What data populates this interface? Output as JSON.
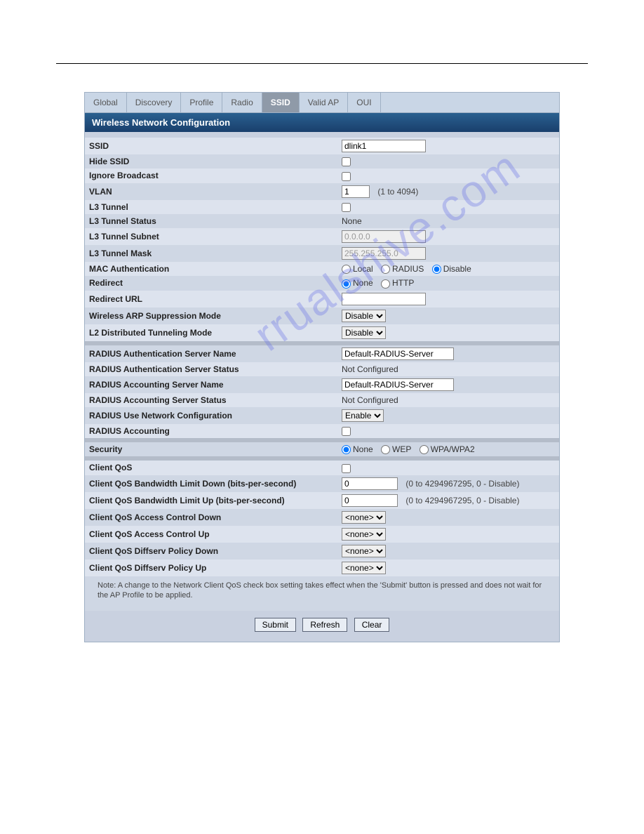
{
  "watermark": "rrualshive.com",
  "tabs": [
    {
      "label": "Global",
      "active": false
    },
    {
      "label": "Discovery",
      "active": false
    },
    {
      "label": "Profile",
      "active": false
    },
    {
      "label": "Radio",
      "active": false
    },
    {
      "label": "SSID",
      "active": true
    },
    {
      "label": "Valid AP",
      "active": false
    },
    {
      "label": "OUI",
      "active": false
    }
  ],
  "section_title": "Wireless Network Configuration",
  "fields": {
    "ssid": {
      "label": "SSID",
      "value": "dlink1"
    },
    "hide_ssid": {
      "label": "Hide SSID",
      "checked": false
    },
    "ignore_broadcast": {
      "label": "Ignore Broadcast",
      "checked": false
    },
    "vlan": {
      "label": "VLAN",
      "value": "1",
      "hint": "(1 to 4094)"
    },
    "l3_tunnel": {
      "label": "L3 Tunnel",
      "checked": false
    },
    "l3_tunnel_status": {
      "label": "L3 Tunnel Status",
      "value": "None"
    },
    "l3_tunnel_subnet": {
      "label": "L3 Tunnel Subnet",
      "value": "0.0.0.0"
    },
    "l3_tunnel_mask": {
      "label": "L3 Tunnel Mask",
      "value": "255.255.255.0"
    },
    "mac_auth": {
      "label": "MAC Authentication",
      "options": [
        "Local",
        "RADIUS",
        "Disable"
      ],
      "selected": "Disable"
    },
    "redirect": {
      "label": "Redirect",
      "options": [
        "None",
        "HTTP"
      ],
      "selected": "None"
    },
    "redirect_url": {
      "label": "Redirect URL",
      "value": ""
    },
    "arp_supp": {
      "label": "Wireless ARP Suppression Mode",
      "value": "Disable"
    },
    "l2_tunnel": {
      "label": "L2 Distributed Tunneling Mode",
      "value": "Disable"
    },
    "radius_auth_name": {
      "label": "RADIUS Authentication Server Name",
      "value": "Default-RADIUS-Server"
    },
    "radius_auth_status": {
      "label": "RADIUS Authentication Server Status",
      "value": "Not Configured"
    },
    "radius_acct_name": {
      "label": "RADIUS Accounting Server Name",
      "value": "Default-RADIUS-Server"
    },
    "radius_acct_status": {
      "label": "RADIUS Accounting Server Status",
      "value": "Not Configured"
    },
    "radius_use_net": {
      "label": "RADIUS Use Network Configuration",
      "value": "Enable"
    },
    "radius_accounting": {
      "label": "RADIUS Accounting",
      "checked": false
    },
    "security": {
      "label": "Security",
      "options": [
        "None",
        "WEP",
        "WPA/WPA2"
      ],
      "selected": "None"
    },
    "client_qos": {
      "label": "Client QoS",
      "checked": false
    },
    "qos_bw_down": {
      "label": "Client QoS Bandwidth Limit Down (bits-per-second)",
      "value": "0",
      "hint": "(0 to 4294967295, 0 - Disable)"
    },
    "qos_bw_up": {
      "label": "Client QoS Bandwidth Limit Up (bits-per-second)",
      "value": "0",
      "hint": "(0 to 4294967295, 0 - Disable)"
    },
    "qos_acl_down": {
      "label": "Client QoS Access Control Down",
      "value": "<none>"
    },
    "qos_acl_up": {
      "label": "Client QoS Access Control Up",
      "value": "<none>"
    },
    "qos_diff_down": {
      "label": "Client QoS Diffserv Policy Down",
      "value": "<none>"
    },
    "qos_diff_up": {
      "label": "Client QoS Diffserv Policy Up",
      "value": "<none>"
    }
  },
  "note": "Note: A change to the Network Client QoS check box setting takes effect when the 'Submit' button is pressed and does not wait for the AP Profile to be applied.",
  "buttons": {
    "submit": "Submit",
    "refresh": "Refresh",
    "clear": "Clear"
  }
}
